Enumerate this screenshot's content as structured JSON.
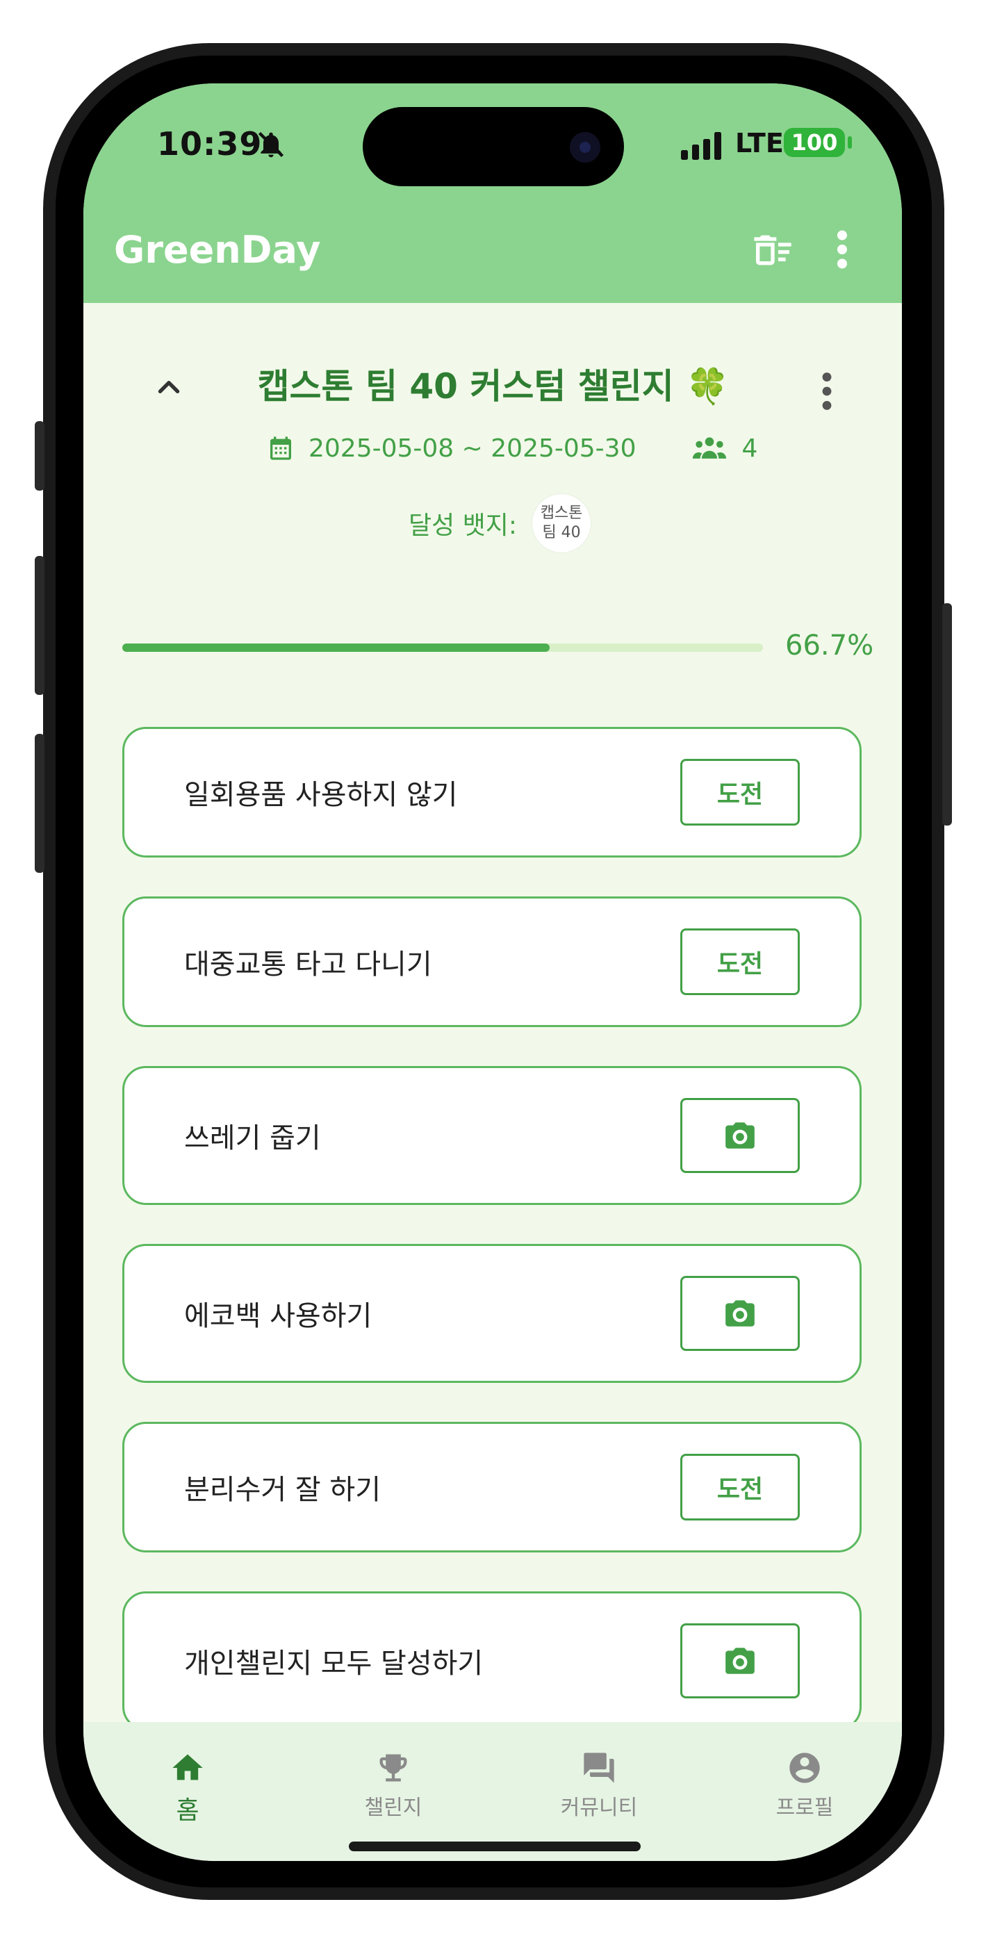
{
  "status_bar": {
    "time": "10:39",
    "network": "LTE",
    "battery": "100"
  },
  "app_bar": {
    "title": "GreenDay"
  },
  "challenge": {
    "title": "캡스톤 팀 40 커스텀 챌린지 🍀",
    "date_range": "2025-05-08 ~ 2025-05-30",
    "member_count": "4",
    "badge_label": "달성 뱃지:",
    "badge_text_line1": "캡스톤",
    "badge_text_line2": "팀 40",
    "progress_percent": 66.7,
    "progress_text": "66.7%"
  },
  "tasks": [
    {
      "label": "일회용품 사용하지 않기",
      "action": "도전"
    },
    {
      "label": "대중교통 타고 다니기",
      "action": "도전"
    },
    {
      "label": "쓰레기 줍기",
      "action": "camera-icon"
    },
    {
      "label": "에코백 사용하기",
      "action": "camera-icon"
    },
    {
      "label": "분리수거 잘 하기",
      "action": "도전"
    },
    {
      "label": "개인챌린지 모두 달성하기",
      "action": "camera-icon"
    }
  ],
  "bottom_nav": [
    {
      "label": "홈",
      "icon": "home-icon",
      "active": true
    },
    {
      "label": "챌린지",
      "icon": "trophy-icon",
      "active": false
    },
    {
      "label": "커뮤니티",
      "icon": "forum-icon",
      "active": false
    },
    {
      "label": "프로필",
      "icon": "account-circle-icon",
      "active": false
    }
  ],
  "colors": {
    "primary": "#8bd48f",
    "accent": "#43a047",
    "dark_green": "#2e7d32",
    "background": "#f2f9ea"
  }
}
